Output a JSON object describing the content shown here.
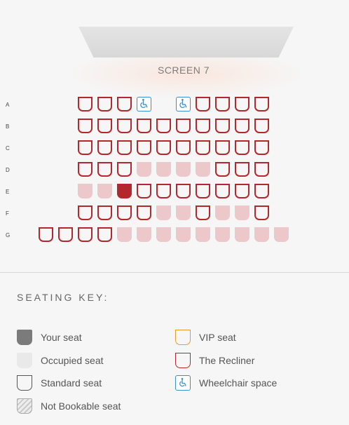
{
  "screen": {
    "label": "SCREEN 7"
  },
  "rows": [
    {
      "label": "A",
      "seats": [
        "free",
        "free",
        "free",
        "wheelchair",
        "gap",
        "wheelchair",
        "free",
        "free",
        "free",
        "free"
      ]
    },
    {
      "label": "B",
      "seats": [
        "free",
        "free",
        "free",
        "free",
        "free",
        "free",
        "free",
        "free",
        "free",
        "free"
      ]
    },
    {
      "label": "C",
      "seats": [
        "free",
        "free",
        "free",
        "free",
        "free",
        "free",
        "free",
        "free",
        "free",
        "free"
      ]
    },
    {
      "label": "D",
      "seats": [
        "free",
        "free",
        "free",
        "occupied",
        "occupied",
        "occupied",
        "occupied",
        "free",
        "free",
        "free"
      ]
    },
    {
      "label": "E",
      "seats": [
        "occupied",
        "occupied",
        "yours",
        "free",
        "free",
        "free",
        "free",
        "free",
        "free",
        "free"
      ]
    },
    {
      "label": "F",
      "seats": [
        "free",
        "free",
        "free",
        "free",
        "occupied",
        "occupied",
        "free",
        "occupied",
        "occupied",
        "free"
      ]
    },
    {
      "label": "G",
      "seats": [
        "free",
        "free",
        "free",
        "free",
        "occupied",
        "occupied",
        "occupied",
        "occupied",
        "occupied",
        "occupied",
        "occupied",
        "occupied",
        "occupied"
      ]
    }
  ],
  "key": {
    "title": "SEATING KEY:",
    "items": [
      {
        "id": "your",
        "label": "Your seat"
      },
      {
        "id": "occupied",
        "label": "Occupied seat"
      },
      {
        "id": "standard",
        "label": "Standard seat"
      },
      {
        "id": "not-bookable",
        "label": "Not Bookable seat"
      },
      {
        "id": "vip",
        "label": "VIP seat"
      },
      {
        "id": "recliner",
        "label": "The Recliner"
      },
      {
        "id": "wheelchair",
        "label": "Wheelchair space"
      }
    ]
  },
  "colors": {
    "recliner": "#b3282d",
    "occupied": "#ecc8ca",
    "vip": "#e49d2d",
    "wheelchair": "#3c8fc9",
    "your_seat_key": "#7b7b7b"
  },
  "icons": {
    "wheelchair": "wheelchair-icon"
  }
}
